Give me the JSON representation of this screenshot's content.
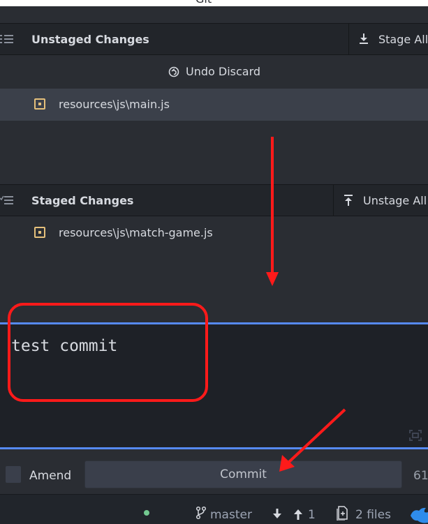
{
  "panel_title": "Git",
  "unstaged": {
    "title": "Unstaged Changes",
    "stage_all_label": "Stage All",
    "undo_label": "Undo Discard",
    "files": [
      {
        "name": "resources\\js\\main.js",
        "status": "modified",
        "selected": true
      }
    ]
  },
  "staged": {
    "title": "Staged Changes",
    "unstage_all_label": "Unstage All",
    "files": [
      {
        "name": "resources\\js\\match-game.js",
        "status": "modified",
        "selected": false
      }
    ]
  },
  "commit": {
    "message": "test commit",
    "amend_label": "Amend",
    "button_label": "Commit",
    "char_count": "61"
  },
  "status_bar": {
    "branch": "master",
    "ahead": "1",
    "files": "2 files"
  },
  "colors": {
    "accent": "#568af2",
    "modified": "#e5c07b",
    "annotation": "#ff1a1a",
    "status_dot": "#73c990",
    "editor_bg": "#1e2127",
    "panel_bg": "#2a2d33"
  },
  "icons": {
    "list": "list-icon",
    "stage_all": "stage-all-icon",
    "unstage_all": "unstage-all-icon",
    "undo": "undo-icon",
    "modified": "modified-file-icon",
    "branch": "branch-icon",
    "fetch": "arrow-down-icon",
    "push": "arrow-up-icon",
    "files": "files-icon",
    "expand": "expand-icon",
    "github": "github-bird-icon"
  }
}
